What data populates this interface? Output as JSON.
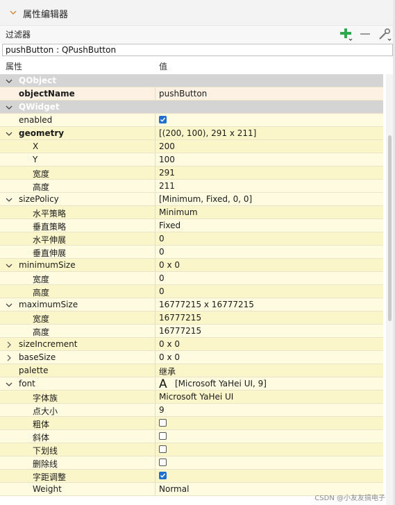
{
  "panel": {
    "title": "属性编辑器"
  },
  "filter": {
    "label": "过滤器"
  },
  "object_class": "pushButton : QPushButton",
  "columns": {
    "property": "属性",
    "value": "值"
  },
  "rows": [
    {
      "kind": "cat",
      "name": "QObject"
    },
    {
      "name": "objectName",
      "value": "pushButton",
      "bold": true,
      "bg": "hl"
    },
    {
      "kind": "cat",
      "name": "QWidget"
    },
    {
      "name": "enabled",
      "check": true,
      "bg": "yA"
    },
    {
      "name": "geometry",
      "value": "[(200, 100), 291 x 211]",
      "bold": true,
      "expand": "open",
      "bg": "yB"
    },
    {
      "name": "X",
      "value": "200",
      "child": true,
      "bg": "yB"
    },
    {
      "name": "Y",
      "value": "100",
      "child": true,
      "bg": "yA"
    },
    {
      "name": "宽度",
      "value": "291",
      "child": true,
      "bg": "yB"
    },
    {
      "name": "高度",
      "value": "211",
      "child": true,
      "bg": "yA"
    },
    {
      "name": "sizePolicy",
      "value": "[Minimum, Fixed, 0, 0]",
      "expand": "open",
      "bg": "yA"
    },
    {
      "name": "水平策略",
      "value": "Minimum",
      "child": true,
      "bg": "yB"
    },
    {
      "name": "垂直策略",
      "value": "Fixed",
      "child": true,
      "bg": "yA"
    },
    {
      "name": "水平伸展",
      "value": "0",
      "child": true,
      "bg": "yB"
    },
    {
      "name": "垂直伸展",
      "value": "0",
      "child": true,
      "bg": "yA"
    },
    {
      "name": "minimumSize",
      "value": "0 x 0",
      "expand": "open",
      "bg": "yB"
    },
    {
      "name": "宽度",
      "value": "0",
      "child": true,
      "bg": "yA"
    },
    {
      "name": "高度",
      "value": "0",
      "child": true,
      "bg": "yB"
    },
    {
      "name": "maximumSize",
      "value": "16777215 x 16777215",
      "expand": "open",
      "bg": "yA"
    },
    {
      "name": "宽度",
      "value": "16777215",
      "child": true,
      "bg": "yB"
    },
    {
      "name": "高度",
      "value": "16777215",
      "child": true,
      "bg": "yA"
    },
    {
      "name": "sizeIncrement",
      "value": "0 x 0",
      "expand": "closed",
      "bg": "yB"
    },
    {
      "name": "baseSize",
      "value": "0 x 0",
      "expand": "closed",
      "bg": "yA"
    },
    {
      "name": "palette",
      "value": "继承",
      "bg": "yB"
    },
    {
      "name": "font",
      "value": "[Microsoft YaHei UI, 9]",
      "expand": "open",
      "fontIcon": true,
      "bg": "yA"
    },
    {
      "name": "字体族",
      "value": "Microsoft YaHei UI",
      "child": true,
      "bg": "yB"
    },
    {
      "name": "点大小",
      "value": "9",
      "child": true,
      "bg": "yA"
    },
    {
      "name": "粗体",
      "check": false,
      "child": true,
      "bg": "yB"
    },
    {
      "name": "斜体",
      "check": false,
      "child": true,
      "bg": "yA"
    },
    {
      "name": "下划线",
      "check": false,
      "child": true,
      "bg": "yB"
    },
    {
      "name": "删除线",
      "check": false,
      "child": true,
      "bg": "yA"
    },
    {
      "name": "字距调整",
      "check": true,
      "child": true,
      "bg": "yB"
    },
    {
      "name": "Weight",
      "value": "Normal",
      "child": true,
      "bg": "yA"
    }
  ],
  "font_icon_glyph": "A",
  "watermark": "CSDN @小友友搞电子",
  "icons": {
    "collapse": "chevron-down-icon",
    "add": "plus-icon",
    "remove": "minus-icon",
    "configure": "wrench-icon"
  },
  "colors": {
    "category_bg": "#d4d4d4",
    "highlight_row": "#fdf1e4",
    "row_yellow_a": "#fffbe0",
    "row_yellow_b": "#fbf6c9",
    "checkbox_on": "#1f6fd1",
    "add_green": "#2fa84f"
  }
}
